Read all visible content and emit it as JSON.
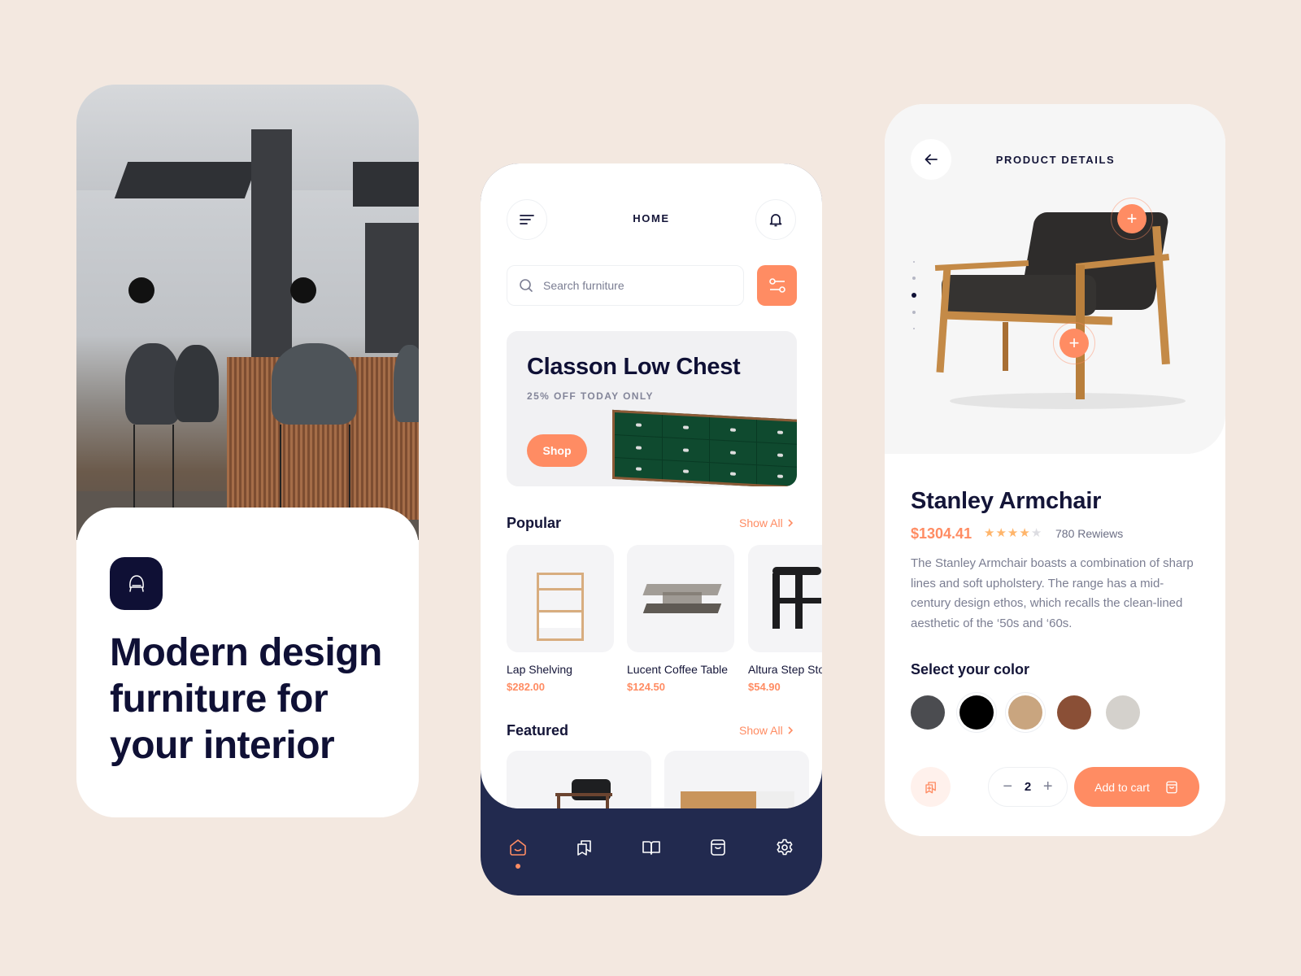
{
  "colors": {
    "background": "#f3e8e0",
    "accent": "#ff8c63",
    "navy": "#0f1035",
    "tabbar": "#222a4f"
  },
  "intro": {
    "logo_icon": "armchair-icon",
    "headline": "Modern design furniture for your interior",
    "photo": "interior-bar-photo"
  },
  "home": {
    "header": {
      "title": "HOME",
      "menu_icon": "menu-icon",
      "notification_icon": "bell-icon"
    },
    "search": {
      "placeholder": "Search furniture",
      "value": "",
      "filter_icon": "filter-icon"
    },
    "promo": {
      "title": "Classon Low Chest",
      "subtitle": "25% OFF TODAY ONLY",
      "button_label": "Shop"
    },
    "popular": {
      "title": "Popular",
      "show_all": "Show All",
      "items": [
        {
          "name": "Lap Shelving",
          "price": "$282.00"
        },
        {
          "name": "Lucent Coffee Table",
          "price": "$124.50"
        },
        {
          "name": "Altura Step Stool",
          "price": "$54.90"
        }
      ]
    },
    "featured": {
      "title": "Featured",
      "show_all": "Show All"
    },
    "tabs": [
      {
        "name": "home",
        "icon": "home-icon",
        "active": true
      },
      {
        "name": "collections",
        "icon": "bookmarks-icon",
        "active": false
      },
      {
        "name": "catalog",
        "icon": "book-icon",
        "active": false
      },
      {
        "name": "cart",
        "icon": "bag-icon",
        "active": false
      },
      {
        "name": "settings",
        "icon": "gear-icon",
        "active": false
      }
    ]
  },
  "product": {
    "header": {
      "title": "PRODUCT DETAILS",
      "back_icon": "arrow-left-icon"
    },
    "name": "Stanley Armchair",
    "price": "$1304.41",
    "rating": 4,
    "rating_max": 5,
    "reviews": "780 Rewiews",
    "description": "The Stanley Armchair boasts a combination of sharp lines and soft upholstery. The range has a mid-century design ethos, which recalls the clean-lined aesthetic of the ‘50s and ‘60s.",
    "image_page": {
      "current": 3,
      "total": 5
    },
    "color_title": "Select your color",
    "colors": [
      {
        "name": "charcoal",
        "hex": "#4b4c50",
        "selected": false
      },
      {
        "name": "black",
        "hex": "#000000",
        "selected": true
      },
      {
        "name": "oak",
        "hex": "#c9a57f",
        "selected": true
      },
      {
        "name": "cognac",
        "hex": "#8a4f36",
        "selected": false
      },
      {
        "name": "stone",
        "hex": "#d4d1cc",
        "selected": false
      }
    ],
    "quantity": "2",
    "minus_label": "−",
    "plus_label": "+",
    "add_to_cart": "Add to cart"
  }
}
